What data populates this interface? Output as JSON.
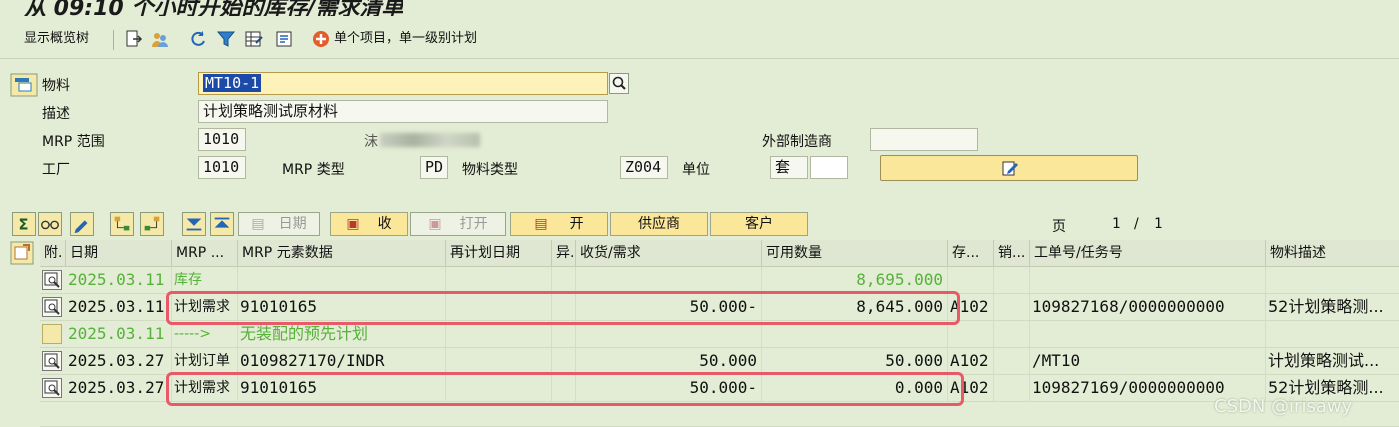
{
  "window": {
    "title": "从 09:10 个小时开始的库存/需求清单"
  },
  "toolbar": {
    "overview_tree_label": "显示概览树",
    "single_item_label": "单个项目，单一级别计划"
  },
  "header": {
    "material_label": "物料",
    "material_value": "MT10-1",
    "description_label": "描述",
    "description_value": "计划策略测试原材料",
    "mrp_area_label": "MRP 范围",
    "mrp_area_value": "1010",
    "mrp_area_desc": "沫",
    "ext_manufacturer_label": "外部制造商",
    "plant_label": "工厂",
    "plant_value": "1010",
    "mrp_type_label": "MRP 类型",
    "mrp_type_value": "PD",
    "material_type_label": "物料类型",
    "material_type_value": "Z004",
    "unit_label": "单位",
    "unit_value": "套"
  },
  "grid_toolbar": {
    "date_btn": "日期",
    "receipt_btn": "收",
    "open_btn": "打开",
    "open2_btn": "开",
    "vendor_btn": "供应商",
    "customer_btn": "客户",
    "page_label": "页",
    "page_current": "1",
    "page_sep": "/",
    "page_total": "1"
  },
  "table": {
    "columns": [
      "附.",
      "日期",
      "MRP ...",
      "MRP 元素数据",
      "再计划日期",
      "异.",
      "收货/需求",
      "可用数量",
      "存...",
      "销...",
      "工单号/任务号",
      "物料描述"
    ],
    "rows": [
      {
        "date": "2025.03.11",
        "mrp": "库存",
        "element": "",
        "rescheduling": "",
        "exc": "",
        "receipt": "",
        "available": "8,695.000",
        "storage": "",
        "sales": "",
        "order": "",
        "desc": "",
        "style": "green"
      },
      {
        "date": "2025.03.11",
        "mrp": "计划需求",
        "element": "91010165",
        "rescheduling": "",
        "exc": "",
        "receipt": "50.000-",
        "available": "8,645.000",
        "storage": "A102",
        "sales": "",
        "order": "109827168/0000000000",
        "desc": "52计划策略测...",
        "style": "normal"
      },
      {
        "date": "2025.03.11",
        "mrp": "----->",
        "element": "无装配的预先计划",
        "rescheduling": "",
        "exc": "",
        "receipt": "",
        "available": "",
        "storage": "",
        "sales": "",
        "order": "",
        "desc": "",
        "style": "green"
      },
      {
        "date": "2025.03.27",
        "mrp": "计划订单",
        "element": "0109827170/INDR",
        "rescheduling": "",
        "exc": "",
        "receipt": "50.000",
        "available": "50.000",
        "storage": "A102",
        "sales": "",
        "order": "/MT10",
        "desc": "计划策略测试...",
        "style": "normal"
      },
      {
        "date": "2025.03.27",
        "mrp": "计划需求",
        "element": "91010165",
        "rescheduling": "",
        "exc": "",
        "receipt": "50.000-",
        "available": "0.000",
        "storage": "A102",
        "sales": "",
        "order": "109827169/0000000000",
        "desc": "52计划策略测...",
        "style": "normal"
      }
    ]
  },
  "watermark": "CSDN @irisawy",
  "colors": {
    "highlight": "#e85a68",
    "green_text": "#56b23a",
    "button_yellow": "#fbe79a"
  }
}
